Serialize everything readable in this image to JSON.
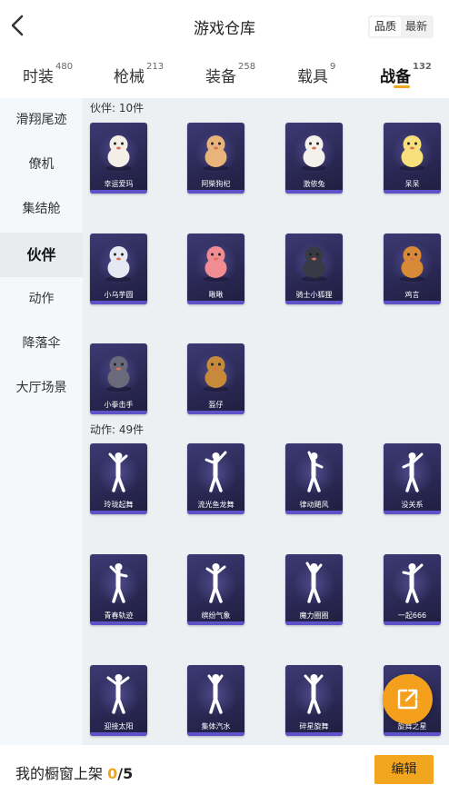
{
  "header": {
    "title": "游戏仓库",
    "sort_options": [
      "品质",
      "最新"
    ],
    "sort_selected": "品质"
  },
  "tabs": [
    {
      "label": "时装",
      "count": "480"
    },
    {
      "label": "枪械",
      "count": "213"
    },
    {
      "label": "装备",
      "count": "258"
    },
    {
      "label": "载具",
      "count": "9"
    },
    {
      "label": "战备",
      "count": "132"
    }
  ],
  "active_tab": "战备",
  "sidebar": {
    "items": [
      "滑翔尾迹",
      "僚机",
      "集结舱",
      "伙伴",
      "动作",
      "降落伞",
      "大厅场景"
    ],
    "active": "伙伴"
  },
  "sections": {
    "companions": {
      "label": "伙伴: 10件",
      "items": [
        {
          "name": "幸运爱玛",
          "icon": "companion-figure"
        },
        {
          "name": "阿柴狗杞",
          "icon": "companion-figure"
        },
        {
          "name": "激依兔",
          "icon": "companion-figure"
        },
        {
          "name": "呆呆",
          "icon": "companion-figure"
        },
        {
          "name": "小乌芋圆",
          "icon": "companion-figure"
        },
        {
          "name": "啾啾",
          "icon": "companion-figure"
        },
        {
          "name": "骑士小狐狸",
          "icon": "companion-figure"
        },
        {
          "name": "鸡言",
          "icon": "companion-figure"
        },
        {
          "name": "小拳击手",
          "icon": "companion-figure"
        },
        {
          "name": "盔仔",
          "icon": "companion-figure"
        }
      ]
    },
    "emotes": {
      "label": "动作: 49件",
      "items": [
        {
          "name": "玲珑起舞",
          "icon": "dancer-silhouette"
        },
        {
          "name": "流光鱼龙舞",
          "icon": "dancer-silhouette"
        },
        {
          "name": "律动飓风",
          "icon": "dancer-silhouette"
        },
        {
          "name": "没关系",
          "icon": "dancer-silhouette"
        },
        {
          "name": "青春轨迹",
          "icon": "dancer-silhouette"
        },
        {
          "name": "缤纷气象",
          "icon": "dancer-silhouette"
        },
        {
          "name": "魔力圈圈",
          "icon": "dancer-silhouette"
        },
        {
          "name": "一起666",
          "icon": "dancer-silhouette"
        },
        {
          "name": "迎接太阳",
          "icon": "dancer-silhouette"
        },
        {
          "name": "集体汽水",
          "icon": "dancer-silhouette"
        },
        {
          "name": "碎星旋舞",
          "icon": "dancer-silhouette"
        },
        {
          "name": "旋舞之星",
          "icon": "dancer-silhouette"
        }
      ]
    }
  },
  "footer": {
    "label": "我的橱窗上架",
    "count": "0",
    "total": "/5",
    "edit_label": "编辑"
  },
  "colors": {
    "accent": "#f2a51e",
    "card_bg": "#2b2955",
    "card_stripe": "#5d52c8"
  }
}
